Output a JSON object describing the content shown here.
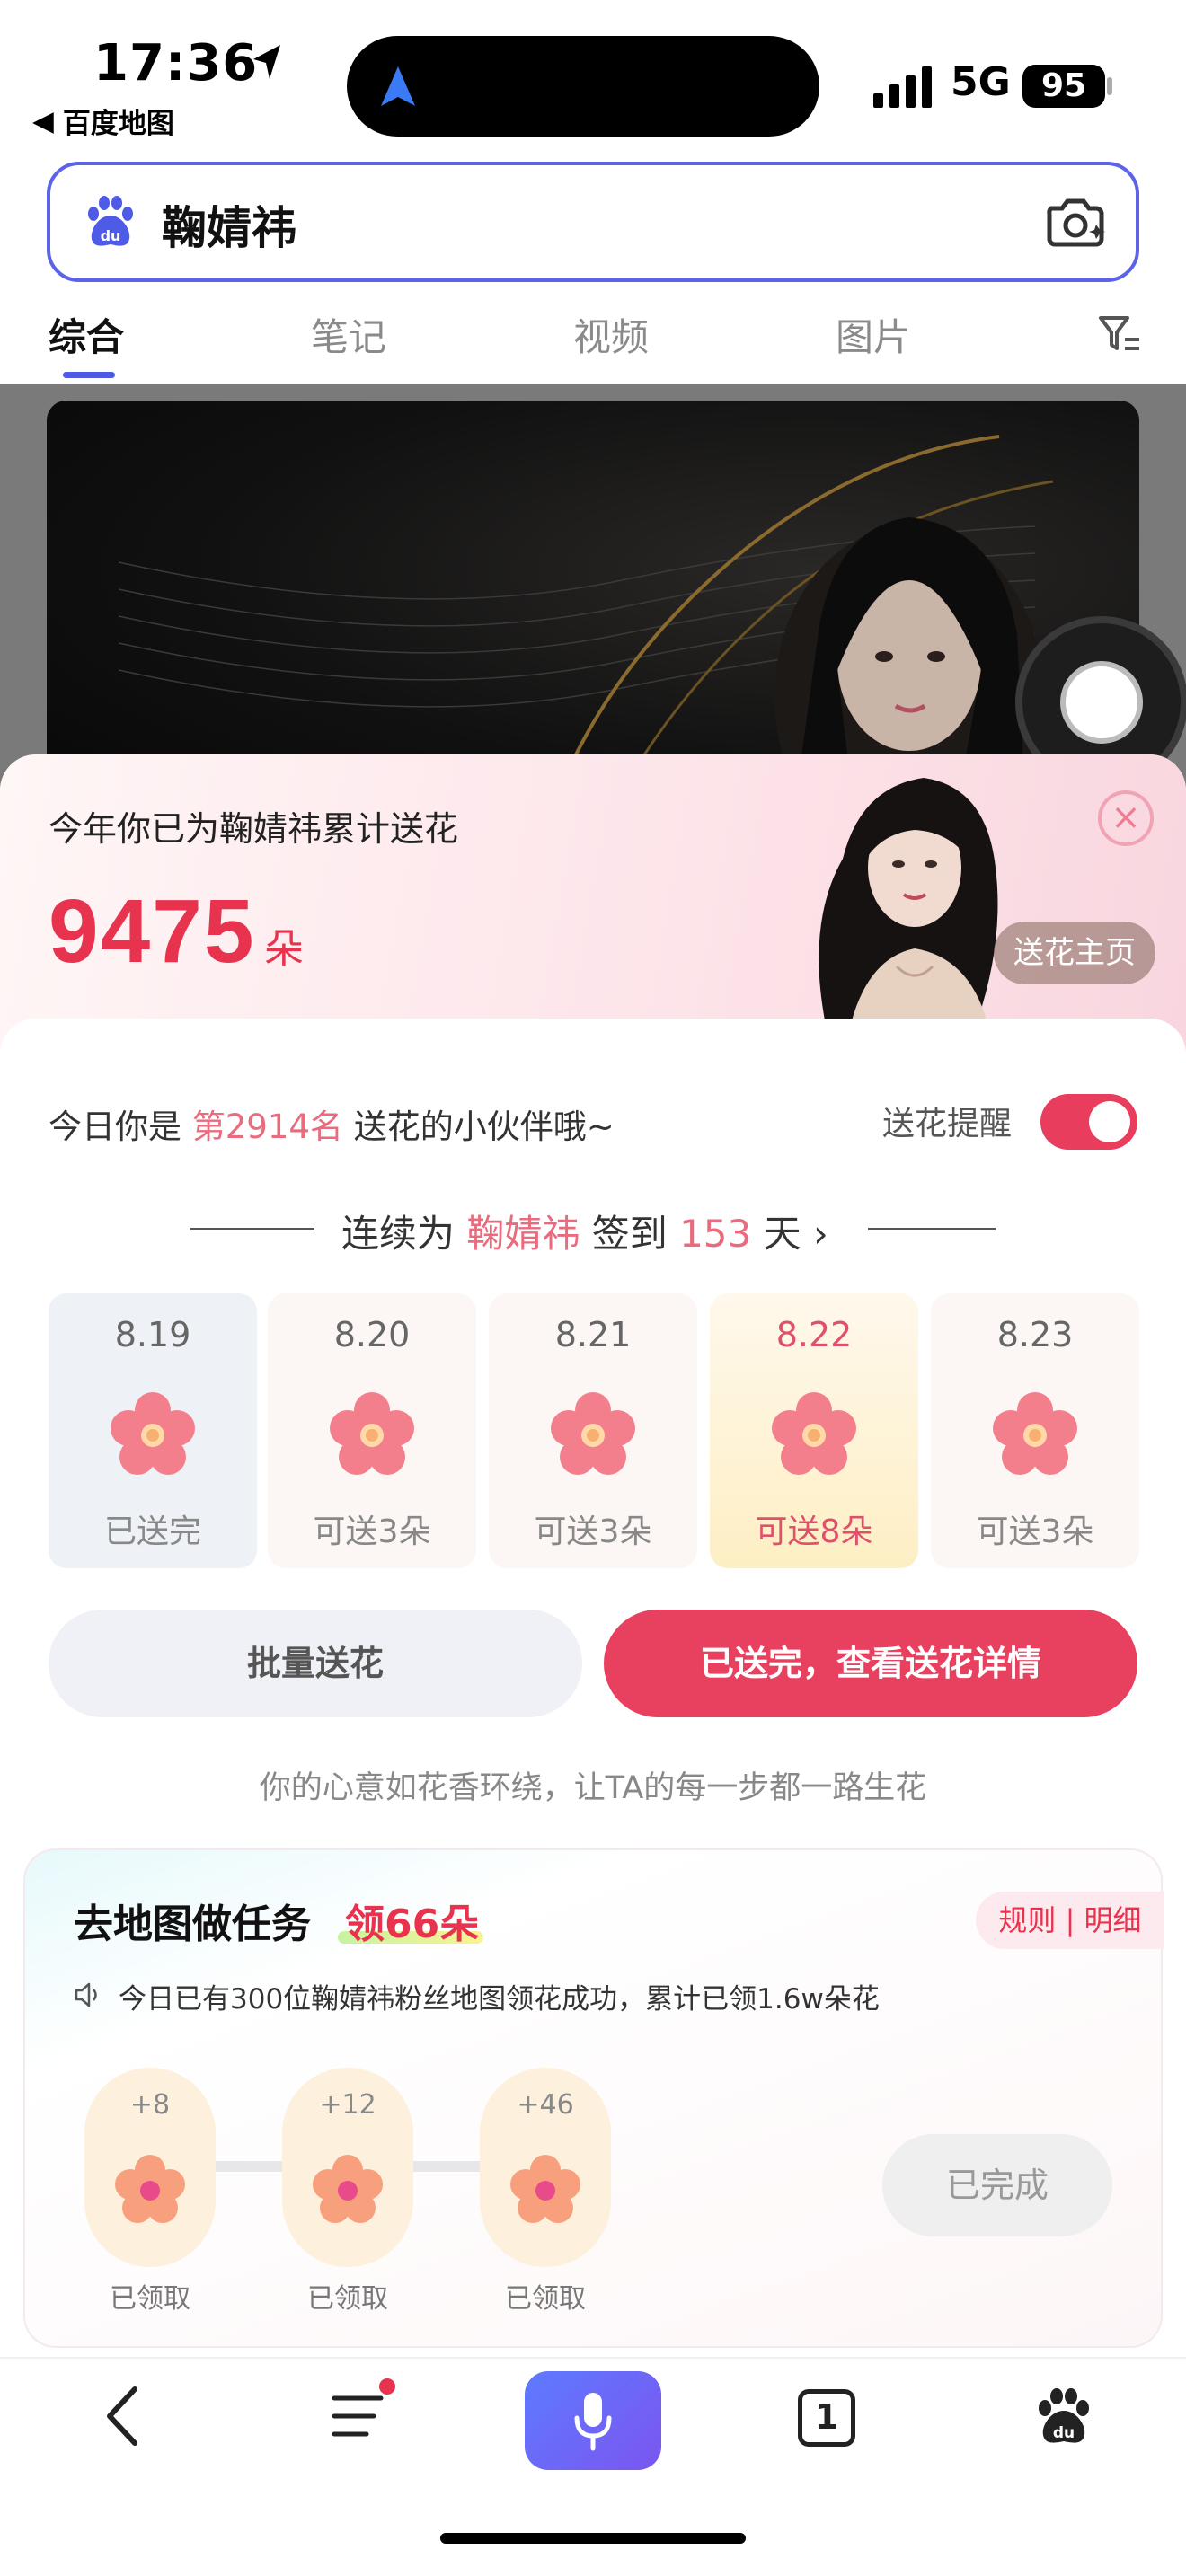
{
  "status_bar": {
    "time": "17:36",
    "back_app": "百度地图",
    "network": "5G",
    "battery": "95"
  },
  "search": {
    "query": "鞠婧祎"
  },
  "tabs": [
    {
      "label": "综合"
    },
    {
      "label": "笔记"
    },
    {
      "label": "视频"
    },
    {
      "label": "图片"
    }
  ],
  "panel": {
    "headline": "今年你已为鞠婧祎累计送花",
    "count": "9475",
    "unit": "朵",
    "close": "×",
    "home_button": "送花主页",
    "rank_prefix": "今日你是 ",
    "rank": "第2914名",
    "rank_suffix": " 送花的小伙伴哦~",
    "remind_label": "送花提醒",
    "remind_on": true,
    "checkin_prefix": "连续为 ",
    "checkin_name": "鞠婧祎",
    "checkin_mid": " 签到 ",
    "checkin_days": "153",
    "checkin_suffix": " 天",
    "chevron": "›",
    "days": [
      {
        "date": "8.19",
        "status": "已送完"
      },
      {
        "date": "8.20",
        "status": "可送3朵"
      },
      {
        "date": "8.21",
        "status": "可送3朵"
      },
      {
        "date": "8.22",
        "status": "可送8朵"
      },
      {
        "date": "8.23",
        "status": "可送3朵"
      }
    ],
    "batch_button": "批量送花",
    "detail_button": "已送完，查看送花详情",
    "slogan": "你的心意如花香环绕，让TA的每一步都一路生花"
  },
  "task": {
    "title": "去地图做任务",
    "reward": "领66朵",
    "rules": "规则 | 明细",
    "notice": "今日已有300位鞠婧祎粉丝地图领花成功，累计已领1.6w朵花",
    "rewards": [
      {
        "amount": "+8",
        "label": "已领取"
      },
      {
        "amount": "+12",
        "label": "已领取"
      },
      {
        "amount": "+46",
        "label": "已领取"
      }
    ],
    "done_button": "已完成"
  },
  "bottom_nav": {
    "tab_count": "1"
  },
  "colors": {
    "accent": "#e8334e",
    "brand_blue": "#4e5be6"
  }
}
